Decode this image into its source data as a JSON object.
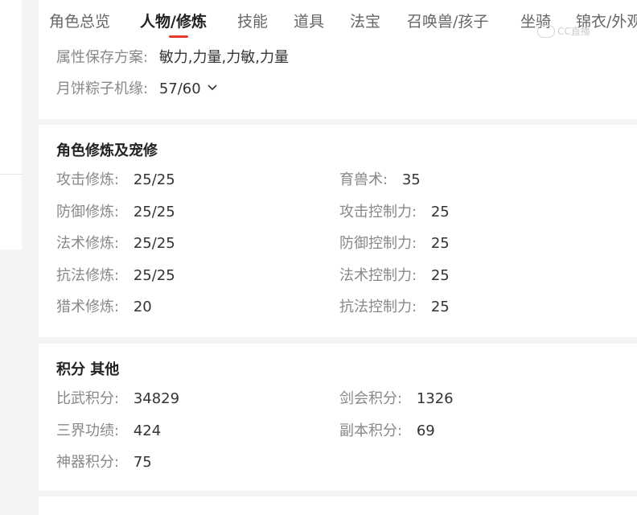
{
  "tabs": [
    {
      "label": "角色总览"
    },
    {
      "label": "人物/修炼"
    },
    {
      "label": "技能"
    },
    {
      "label": "道具"
    },
    {
      "label": "法宝"
    },
    {
      "label": "召唤兽/孩子"
    },
    {
      "label": "坐骑"
    },
    {
      "label": "锦衣/外观"
    }
  ],
  "watermark": "CC直播",
  "info": {
    "attr_scheme_label": "属性保存方案:",
    "attr_scheme_value": "敏力,力量,力敏,力量",
    "yuebing_label": "月饼粽子机缘:",
    "yuebing_value": "57/60"
  },
  "xiulian": {
    "title": "角色修炼及宠修",
    "left": [
      {
        "label": "攻击修炼:",
        "value": "25/25"
      },
      {
        "label": "防御修炼:",
        "value": "25/25"
      },
      {
        "label": "法术修炼:",
        "value": "25/25"
      },
      {
        "label": "抗法修炼:",
        "value": "25/25"
      },
      {
        "label": "猎术修炼:",
        "value": "20"
      }
    ],
    "right": [
      {
        "label": "育兽术:",
        "value": "35"
      },
      {
        "label": "攻击控制力:",
        "value": "25"
      },
      {
        "label": "防御控制力:",
        "value": "25"
      },
      {
        "label": "法术控制力:",
        "value": "25"
      },
      {
        "label": "抗法控制力:",
        "value": "25"
      }
    ]
  },
  "jifen": {
    "title": "积分 其他",
    "left": [
      {
        "label": "比武积分:",
        "value": "34829"
      },
      {
        "label": "三界功绩:",
        "value": "424"
      },
      {
        "label": "神器积分:",
        "value": "75"
      }
    ],
    "right": [
      {
        "label": "剑会积分:",
        "value": "1326"
      },
      {
        "label": "副本积分:",
        "value": "69"
      }
    ]
  },
  "colors": {
    "accent": "#e8392f",
    "background": "#f4f4f5",
    "card": "#ffffff",
    "label": "#888888",
    "value": "#333333"
  }
}
